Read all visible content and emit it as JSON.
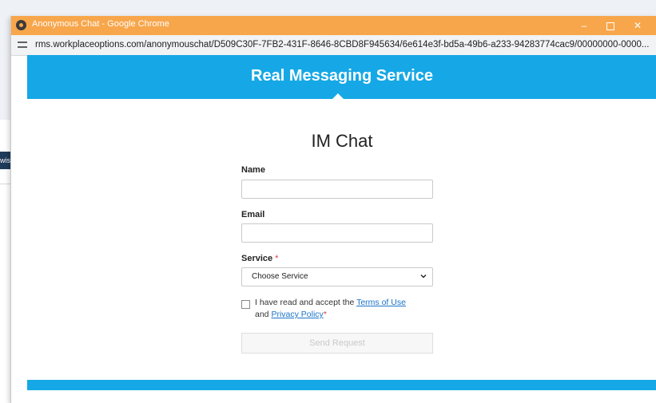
{
  "window": {
    "title": "Anonymous Chat - Google Chrome",
    "url": "rms.workplaceoptions.com/anonymouschat/D509C30F-7FB2-431F-8646-8CBD8F945634/6e614e3f-bd5a-49b6-a233-94283774cac9/00000000-0000...",
    "minimize_icon": "–",
    "close_icon": "✕"
  },
  "background": {
    "tab_label": "wis"
  },
  "banner": {
    "title": "Real Messaging Service"
  },
  "form": {
    "title": "IM Chat",
    "name_label": "Name",
    "email_label": "Email",
    "service_label": "Service",
    "required_mark": "*",
    "service_selected": "Choose Service",
    "terms_prefix": "I have read and accept the",
    "terms_link": "Terms of Use",
    "terms_and": "and",
    "privacy_link": "Privacy Policy",
    "send_label": "Send Request"
  },
  "colors": {
    "titlebar": "#f8a64b",
    "banner": "#16a8e6",
    "link": "#1a73c8"
  }
}
